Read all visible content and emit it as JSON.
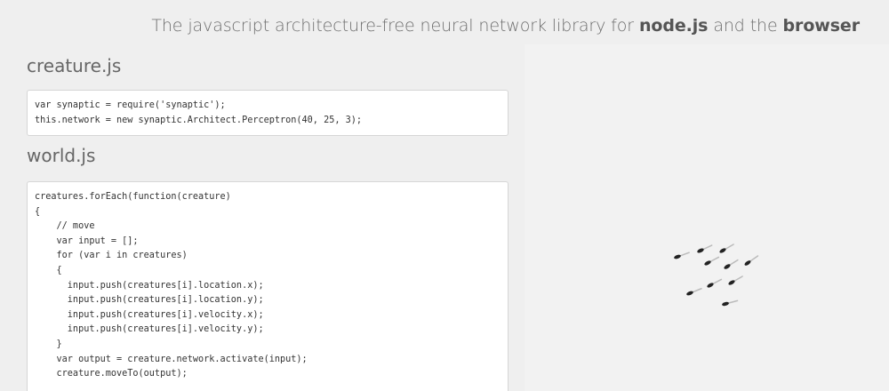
{
  "header": {
    "tagline_prefix": "The javascript architecture-free neural network library for",
    "tagline_bold_1": "node.js",
    "tagline_middle": "and the",
    "tagline_bold_2": "browser"
  },
  "creature_section": {
    "title": "creature.js",
    "code_lines": [
      "var synaptic = require('synaptic');",
      "this.network = new synaptic.Architect.Perceptron(40, 25, 3);"
    ]
  },
  "world_section": {
    "title": "world.js",
    "code_lines": [
      "creatures.forEach(function(creature)",
      "{",
      "    // move",
      "    var input = [];",
      "    for (var i in creatures)",
      "    {",
      "      input.push(creatures[i].location.x);",
      "      input.push(creatures[i].location.y);",
      "      input.push(creatures[i].velocity.x);",
      "      input.push(creatures[i].velocity.y);",
      "    }",
      "    var output = creature.network.activate(input);",
      "    creature.moveTo(output);"
    ]
  },
  "simulation": {
    "creature_color": "#222222",
    "trail_color": "#bbbbbb"
  }
}
